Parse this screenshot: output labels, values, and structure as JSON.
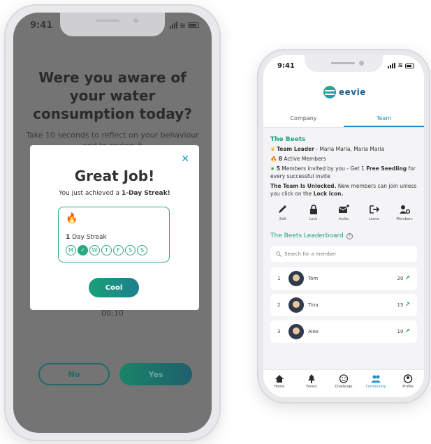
{
  "colors": {
    "accent": "#1fa37a",
    "blue": "#1d8fc8"
  },
  "phone1": {
    "status_time": "9:41",
    "question": "Were you aware of your water consumption today?",
    "subtitle": "Take 10 seconds to reflect on your behaviour and to review it",
    "timer": "00:10",
    "no_label": "No",
    "yes_label": "Yes",
    "modal": {
      "close_icon": "close-icon",
      "title": "Great Job!",
      "sub_prefix": "You just achieved a ",
      "sub_bold": "1-Day Streak!",
      "streak_count": "1",
      "streak_label": " Day Streak",
      "days": [
        "M",
        "✓",
        "W",
        "T",
        "F",
        "S",
        "S"
      ],
      "button": "Cool"
    }
  },
  "phone2": {
    "status_time": "9:41",
    "logo_text": "eevie",
    "tabs": [
      "Company",
      "Team"
    ],
    "active_tab": "Team",
    "team_name": "The Beets",
    "leader_label": "Team Leader",
    "leader_rest": " - Maria Maria, Maria Maria",
    "active_count": "8",
    "active_text": " Active Members",
    "invited_count": "5",
    "invited_text": " Members invited by you - Get 1 ",
    "invited_bold": "Free Seedling",
    "invited_rest": " for every successful invite",
    "unlocked_bold": "The Team Is Unlocked.",
    "unlocked_text": " New members can join unless you click on the ",
    "unlocked_icon": "Lock Icon.",
    "actions": [
      "Edit",
      "Lock",
      "Invite",
      "Leave",
      "Members"
    ],
    "leaderboard_title": "The Beets Leaderboard",
    "search_placeholder": "Search for a member",
    "rows": [
      {
        "rank": "1",
        "name": "Tom",
        "score": "20"
      },
      {
        "rank": "2",
        "name": "Tina",
        "score": "15"
      },
      {
        "rank": "3",
        "name": "Alex",
        "score": "10"
      }
    ],
    "nav": [
      "Home",
      "Forest",
      "Challenge",
      "Community",
      "Profile"
    ],
    "active_nav": "Community"
  }
}
